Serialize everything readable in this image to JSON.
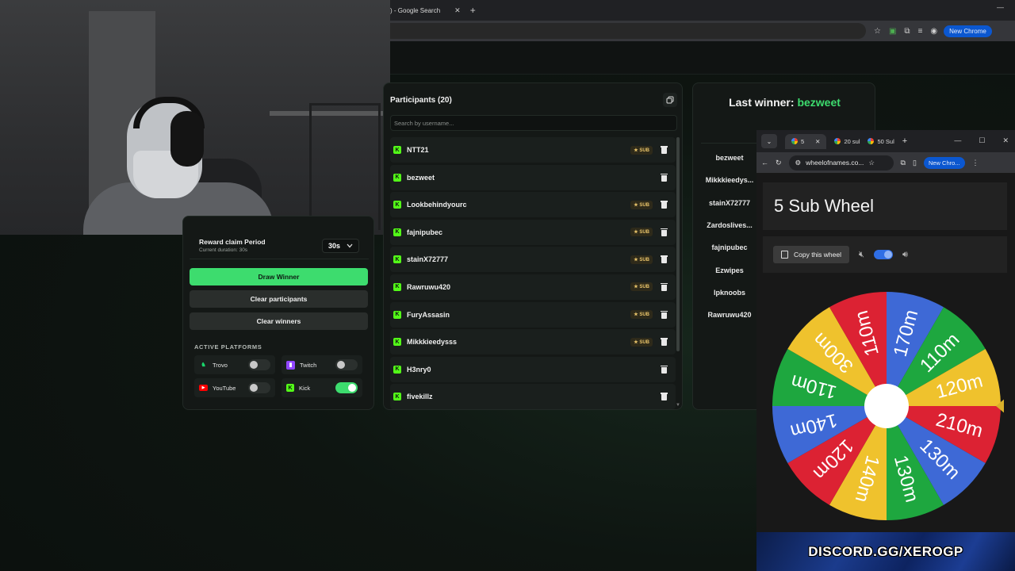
{
  "browser": {
    "tab_title": ") - Google Search",
    "tab_close": "✕",
    "tab_new": "+",
    "new_chrome_label": "New Chrome",
    "minimize": "—"
  },
  "controls": {
    "reward_title": "Reward claim Period",
    "reward_sub": "Current duration: 30s",
    "duration_value": "30s",
    "draw_winner": "Draw Winner",
    "clear_participants": "Clear participants",
    "clear_winners": "Clear winners",
    "platforms_title": "ACTIVE PLATFORMS",
    "platforms": [
      {
        "name": "Trovo",
        "on": false,
        "icon": "trovo-icon",
        "color": "#19d66b"
      },
      {
        "name": "Twitch",
        "on": false,
        "icon": "twitch-icon",
        "color": "#9146ff"
      },
      {
        "name": "YouTube",
        "on": false,
        "icon": "youtube-icon",
        "color": "#ff0000"
      },
      {
        "name": "Kick",
        "on": true,
        "icon": "kick-icon",
        "color": "#53fc18"
      }
    ]
  },
  "participants": {
    "title": "Participants (20)",
    "search_placeholder": "Search by username...",
    "sub_label": "★ SUB",
    "list": [
      {
        "name": "NTT21",
        "sub": true
      },
      {
        "name": "bezweet",
        "sub": false
      },
      {
        "name": "Lookbehindyourc",
        "sub": true
      },
      {
        "name": "fajnipubec",
        "sub": true
      },
      {
        "name": "stainX72777",
        "sub": true
      },
      {
        "name": "Rawruwu420",
        "sub": true
      },
      {
        "name": "FuryAssasin",
        "sub": true
      },
      {
        "name": "Mikkkieedysss",
        "sub": true
      },
      {
        "name": "H3nry0",
        "sub": false
      },
      {
        "name": "fivekillz",
        "sub": false
      }
    ]
  },
  "winners": {
    "label": "Last winner:",
    "name": "bezweet",
    "list": [
      "bezweet",
      "Mikkkieedys...",
      "stainX72777",
      "Zardoslives...",
      "fajnipubec",
      "Ezwipes",
      "lpknoobs",
      "Rawruwu420"
    ]
  },
  "popup": {
    "tabs": [
      {
        "label": "5",
        "active": true
      },
      {
        "label": "20 sul",
        "active": false
      },
      {
        "label": "50 Sul",
        "active": false
      }
    ],
    "tab_close": "✕",
    "tab_new": "+",
    "url": "wheelofnames.co...",
    "new_chrome_label": "New Chro...",
    "wheel_title": "5 Sub Wheel",
    "copy_wheel": "Copy this wheel",
    "sound_on": true,
    "wheel_segments": [
      {
        "label": "170m",
        "color": "#3e69d6"
      },
      {
        "label": "110m",
        "color": "#1ea73f"
      },
      {
        "label": "120m",
        "color": "#efc22d"
      },
      {
        "label": "210m",
        "color": "#dc2233"
      },
      {
        "label": "130m",
        "color": "#3e69d6"
      },
      {
        "label": "130m",
        "color": "#1ea73f"
      },
      {
        "label": "140m",
        "color": "#efc22d"
      },
      {
        "label": "120m",
        "color": "#dc2233"
      },
      {
        "label": "140m",
        "color": "#3e69d6"
      },
      {
        "label": "110m",
        "color": "#1ea73f"
      },
      {
        "label": "300m",
        "color": "#efc22d"
      },
      {
        "label": "110m",
        "color": "#dc2233"
      }
    ]
  },
  "banner": {
    "text": "DISCORD.GG/XEROGP"
  }
}
